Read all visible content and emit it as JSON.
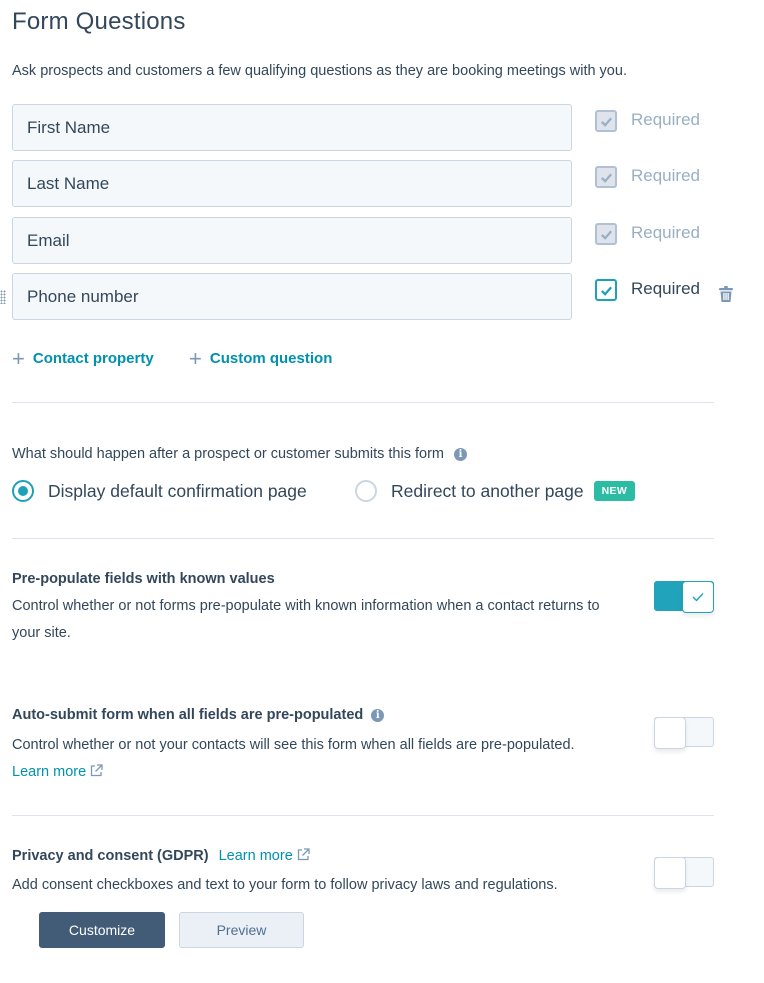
{
  "header": {
    "title": "Form Questions",
    "description": "Ask prospects and customers a few qualifying questions as they are booking meetings with you."
  },
  "fields": [
    {
      "label": "First Name",
      "required_label": "Required",
      "required": true,
      "editable": false
    },
    {
      "label": "Last Name",
      "required_label": "Required",
      "required": true,
      "editable": false
    },
    {
      "label": "Email",
      "required_label": "Required",
      "required": true,
      "editable": false
    },
    {
      "label": "Phone number",
      "required_label": "Required",
      "required": true,
      "editable": true
    }
  ],
  "add_links": {
    "contact_property": "Contact property",
    "custom_question": "Custom question"
  },
  "after_submit": {
    "question": "What should happen after a prospect or customer submits this form",
    "options": [
      {
        "label": "Display default confirmation page",
        "selected": true
      },
      {
        "label": "Redirect to another page",
        "selected": false,
        "badge": "NEW"
      }
    ]
  },
  "settings": {
    "prepopulate": {
      "title": "Pre-populate fields with known values",
      "description": "Control whether or not forms pre-populate with known information when a contact returns to your site.",
      "enabled": true
    },
    "autosubmit": {
      "title": "Auto-submit form when all fields are pre-populated",
      "description": "Control whether or not your contacts will see this form when all fields are pre-populated.",
      "link": "Learn more",
      "enabled": false
    },
    "gdpr": {
      "title": "Privacy and consent (GDPR)",
      "link": "Learn more",
      "description": "Add consent checkboxes and text to your form to follow privacy laws and regulations.",
      "enabled": false
    }
  },
  "buttons": {
    "customize": "Customize",
    "preview": "Preview"
  },
  "colors": {
    "accent": "#00a4bd",
    "link": "#0091ae",
    "text": "#33475b",
    "badge": "#2cbca3",
    "primary_button": "#425b76"
  }
}
